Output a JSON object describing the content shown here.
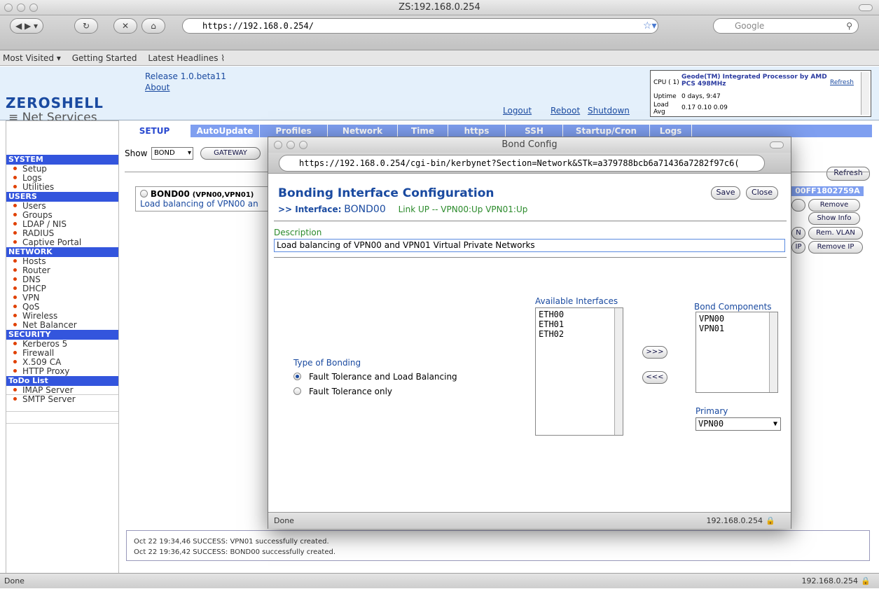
{
  "browser": {
    "window_title": "ZS:192.168.0.254",
    "url": "https://192.168.0.254/",
    "search_placeholder": "Google",
    "bookmarks": [
      "Most Visited ▾",
      "Getting Started",
      "Latest Headlines ⌇"
    ],
    "status_left": "Done",
    "status_right": "192.168.0.254"
  },
  "header": {
    "logo_top": "ZEROSHELL",
    "logo_bottom": "Net Services",
    "release": "Release 1.0.beta11",
    "about": "About",
    "links": [
      "Logout",
      "Reboot",
      "Shutdown"
    ],
    "cpu_label": "CPU ( 1)",
    "cpu_value": "Geode(TM) Integrated Processor by AMD PCS 498MHz",
    "uptime_label": "Uptime",
    "uptime_value": "0 days, 9:47",
    "load_label": "Load Avg",
    "load_value": "0.17 0.10 0.09",
    "refresh": "Refresh"
  },
  "sidebar": {
    "sections": [
      {
        "title": "SYSTEM",
        "items": [
          "Setup",
          "Logs",
          "Utilities"
        ]
      },
      {
        "title": "USERS",
        "items": [
          "Users",
          "Groups",
          "LDAP / NIS",
          "RADIUS",
          "Captive Portal"
        ]
      },
      {
        "title": "NETWORK",
        "items": [
          "Hosts",
          "Router",
          "DNS",
          "DHCP",
          "VPN",
          "QoS",
          "Wireless",
          "Net Balancer"
        ]
      },
      {
        "title": "SECURITY",
        "items": [
          "Kerberos 5",
          "Firewall",
          "X.509 CA",
          "HTTP Proxy"
        ]
      },
      {
        "title": "ToDo List",
        "items": [
          "IMAP Server",
          "SMTP Server"
        ]
      }
    ]
  },
  "tabs": [
    "SETUP",
    "AutoUpdate",
    "Profiles",
    "Network",
    "Time",
    "https",
    "SSH",
    "Startup/Cron",
    "Logs"
  ],
  "main": {
    "show_label": "Show",
    "show_value": "BOND",
    "gateway_btn": "GATEWAY",
    "refresh_btn": "Refresh",
    "bond_name": "BOND00",
    "bond_members": "(VPN00,VPN01)",
    "bond_desc": "Load balancing of VPN00 an",
    "mac": "00FF1802759A",
    "buttons": [
      "Remove",
      "Show Info",
      "Rem. VLAN",
      "Remove IP"
    ],
    "partial_buttons": [
      "N",
      "IP"
    ]
  },
  "log": [
    "Oct 22 19:34,46 SUCCESS: VPN01 successfully created.",
    "Oct 22 19:36,42 SUCCESS: BOND00 successfully created."
  ],
  "popup": {
    "window_title": "Bond Config",
    "url": "https://192.168.0.254/cgi-bin/kerbynet?Section=Network&STk=a379788bcb6a71436a7282f97c6(",
    "heading": "Bonding Interface Configuration",
    "interface_label": ">> Interface:",
    "interface_value": "BOND00",
    "link_status": "Link UP -- VPN00:Up VPN01:Up",
    "save": "Save",
    "close": "Close",
    "description_label": "Description",
    "description_value": "Load balancing of VPN00 and VPN01 Virtual Private Networks",
    "type_label": "Type of Bonding",
    "type_options": [
      "Fault Tolerance and Load Balancing",
      "Fault Tolerance only"
    ],
    "available_label": "Available Interfaces",
    "available": [
      "ETH00",
      "ETH01",
      "ETH02"
    ],
    "add_btn": ">>>",
    "remove_btn": "<<<",
    "components_label": "Bond Components",
    "components": [
      "VPN00",
      "VPN01"
    ],
    "primary_label": "Primary",
    "primary_value": "VPN00",
    "status_left": "Done",
    "status_right": "192.168.0.254"
  }
}
